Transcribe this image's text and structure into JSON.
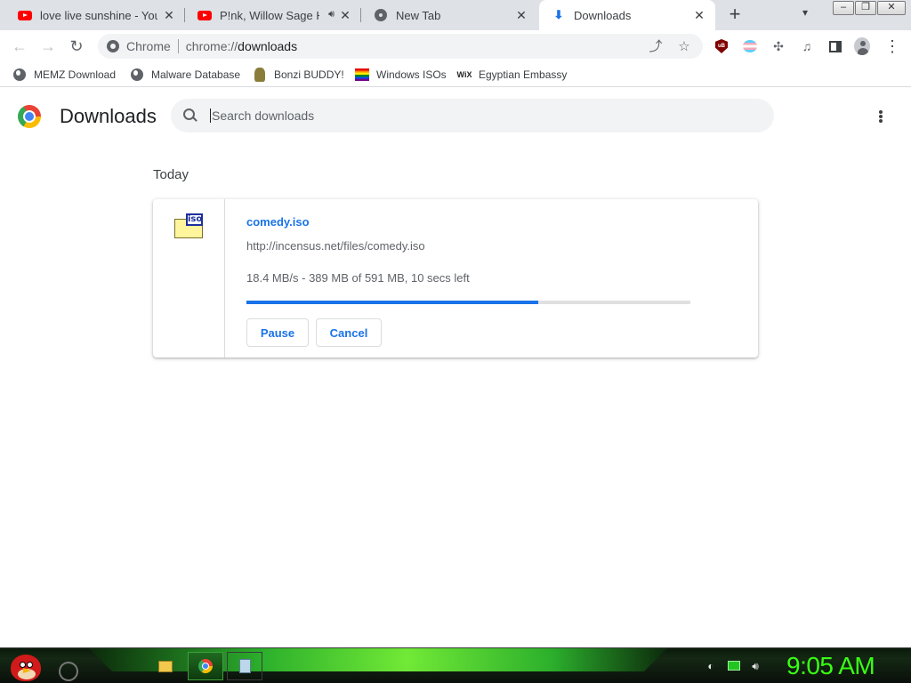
{
  "tabs": [
    {
      "title": "love live sunshine - YouTube",
      "favicon": "youtube-icon"
    },
    {
      "title": "P!nk, Willow Sage Hart",
      "favicon": "youtube-icon",
      "audio": "speaker-icon"
    },
    {
      "title": "New Tab",
      "favicon": "chrome-icon"
    },
    {
      "title": "Downloads",
      "favicon": "download-icon",
      "active": true
    }
  ],
  "toolbar": {
    "omnibox_chip": "Chrome",
    "url_scheme": "chrome://",
    "url_path": "downloads",
    "back": "←",
    "forward": "→",
    "reload": "↻",
    "share": "⤴",
    "star": "☆"
  },
  "bookmarks": [
    {
      "label": "MEMZ Download",
      "icon": "globe-icon"
    },
    {
      "label": "Malware Database",
      "icon": "globe-icon"
    },
    {
      "label": "Bonzi BUDDY!",
      "icon": "bonzi-icon"
    },
    {
      "label": "Windows ISOs",
      "icon": "rainbow-flag-icon"
    },
    {
      "label": "Egyptian Embassy",
      "icon": "wix-icon",
      "icon_text": "WiX"
    }
  ],
  "page": {
    "title": "Downloads",
    "search_placeholder": "Search downloads",
    "date_header": "Today"
  },
  "download": {
    "file_name": "comedy.iso",
    "url": "http://incensus.net/files/comedy.iso",
    "status": "18.4 MB/s - 389 MB of 591 MB, 10 secs left",
    "progress_fraction": 0.658,
    "icon_badge": "iso",
    "pause_label": "Pause",
    "cancel_label": "Cancel"
  },
  "taskbar": {
    "clock": "9:05 AM"
  },
  "colors": {
    "accent": "#1a73e8",
    "tabstrip": "#dee1e6",
    "taskbar_glow": "#39ff14"
  }
}
